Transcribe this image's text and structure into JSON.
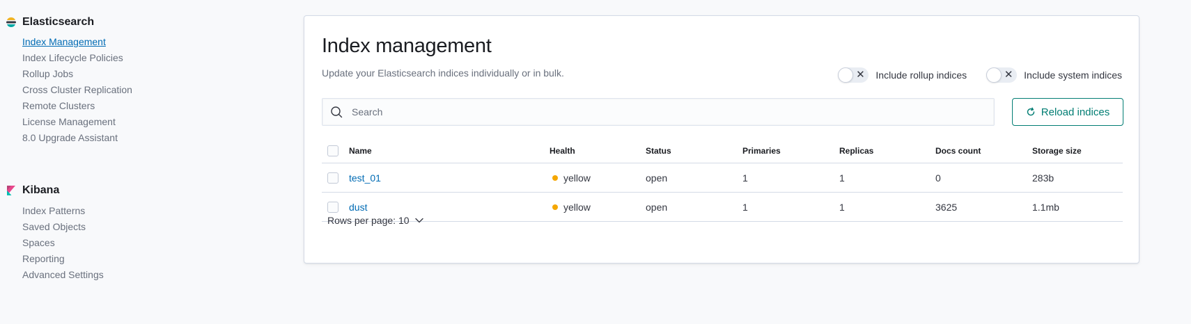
{
  "colors": {
    "link": "#006bb4",
    "accent": "#017d73",
    "health_yellow": "#f5a700"
  },
  "sidebar": {
    "groups": [
      {
        "title": "Elasticsearch",
        "icon": "elasticsearch-logo",
        "items": [
          {
            "label": "Index Management",
            "active": true
          },
          {
            "label": "Index Lifecycle Policies"
          },
          {
            "label": "Rollup Jobs"
          },
          {
            "label": "Cross Cluster Replication"
          },
          {
            "label": "Remote Clusters"
          },
          {
            "label": "License Management"
          },
          {
            "label": "8.0 Upgrade Assistant"
          }
        ]
      },
      {
        "title": "Kibana",
        "icon": "kibana-logo",
        "items": [
          {
            "label": "Index Patterns"
          },
          {
            "label": "Saved Objects"
          },
          {
            "label": "Spaces"
          },
          {
            "label": "Reporting"
          },
          {
            "label": "Advanced Settings"
          }
        ]
      }
    ]
  },
  "main": {
    "title": "Index management",
    "description": "Update your Elasticsearch indices individually or in bulk.",
    "toggles": [
      {
        "label": "Include rollup indices",
        "checked": false
      },
      {
        "label": "Include system indices",
        "checked": false
      }
    ],
    "search": {
      "placeholder": "Search",
      "value": ""
    },
    "reload_label": "Reload indices",
    "table": {
      "columns": [
        "Name",
        "Health",
        "Status",
        "Primaries",
        "Replicas",
        "Docs count",
        "Storage size"
      ],
      "rows": [
        {
          "name": "test_01",
          "health": "yellow",
          "status": "open",
          "primaries": "1",
          "replicas": "1",
          "docs_count": "0",
          "storage_size": "283b"
        },
        {
          "name": "dust",
          "health": "yellow",
          "status": "open",
          "primaries": "1",
          "replicas": "1",
          "docs_count": "3625",
          "storage_size": "1.1mb"
        }
      ]
    },
    "rows_per_page_label": "Rows per page: 10"
  }
}
